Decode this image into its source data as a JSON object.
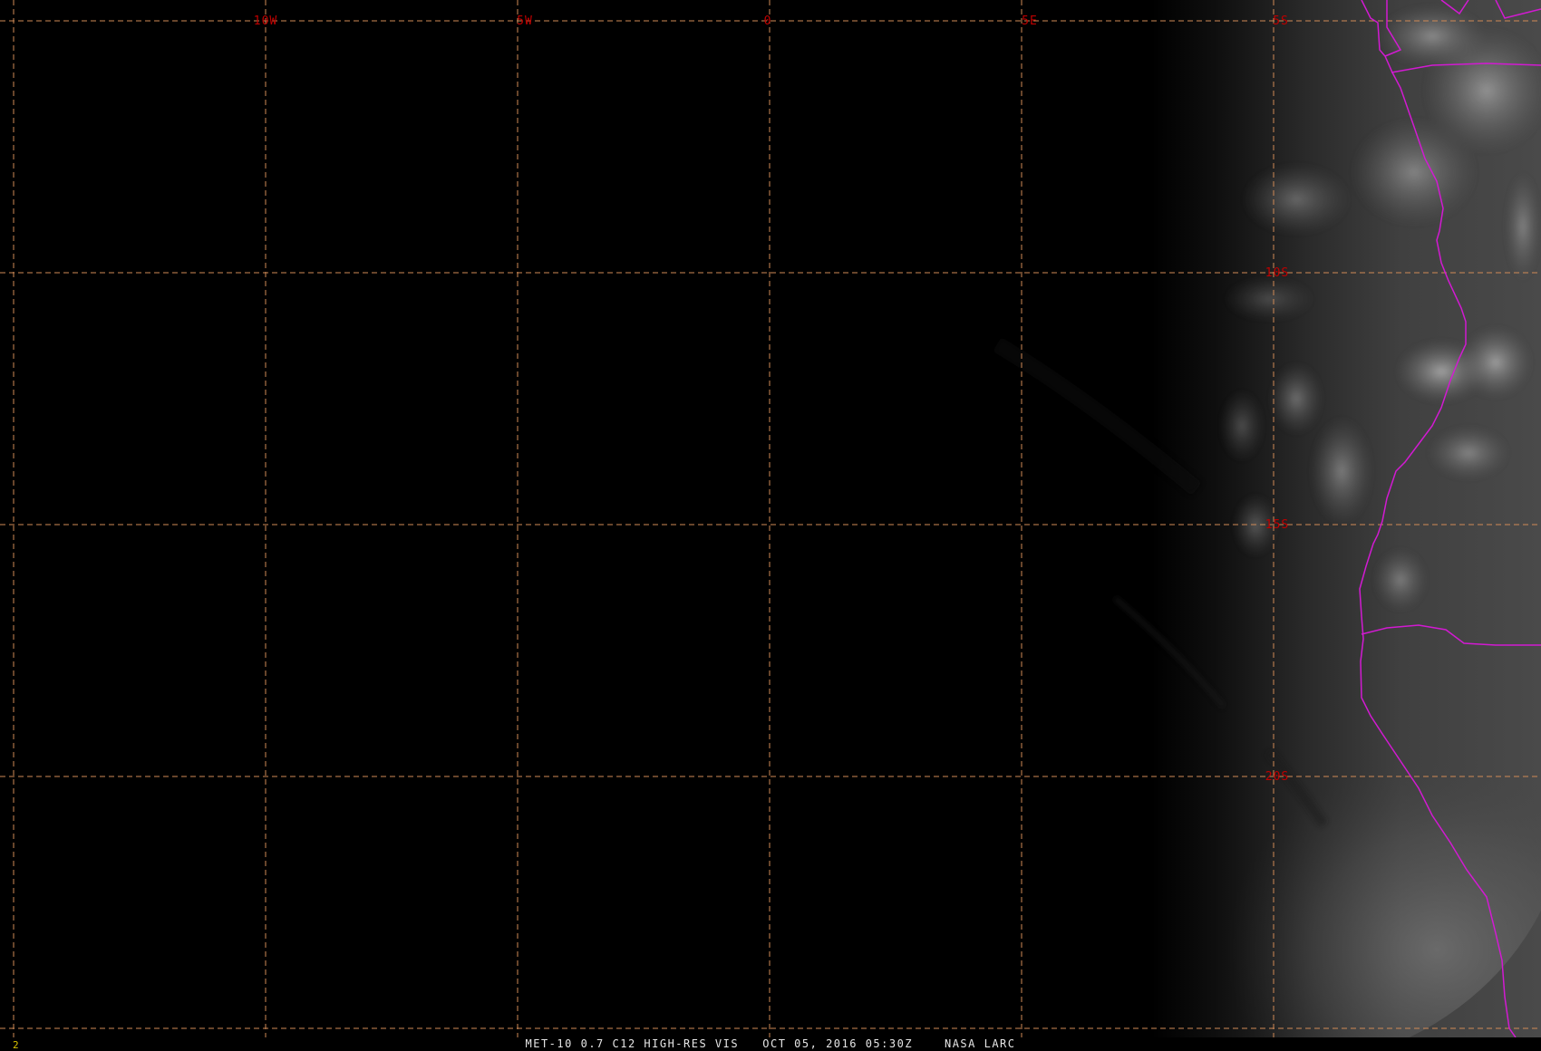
{
  "map": {
    "longitude_labels": [
      "10W",
      "5W",
      "0",
      "5E"
    ],
    "latitude_labels": [
      "5S",
      "10S",
      "15S",
      "20S"
    ],
    "colors": {
      "background": "#000000",
      "graticule": "#d08a56",
      "grid_label": "#c00000",
      "coastline": "#d21ad2"
    }
  },
  "status": {
    "frame_number": "2",
    "satellite": "MET-10",
    "channel": "0.7 C12 HIGH-RES VIS",
    "timestamp": "OCT 05, 2016 05:30Z",
    "source": "NASA LARC"
  }
}
